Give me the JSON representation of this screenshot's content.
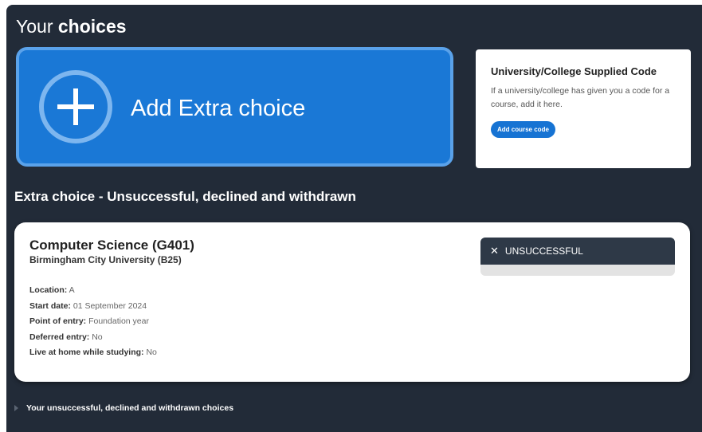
{
  "header": {
    "title_prefix": "Your",
    "title_bold": "choices"
  },
  "add_extra": {
    "label": "Add Extra choice",
    "icon": "plus-circle-icon"
  },
  "code_card": {
    "title": "University/College Supplied Code",
    "description": "If a university/college has given you a code for a course, add it here.",
    "button_label": "Add course code"
  },
  "section": {
    "title": "Extra choice - Unsuccessful, declined and withdrawn"
  },
  "choice": {
    "course": "Computer Science (G401)",
    "university": "Birmingham City University (B25)",
    "status": "UNSUCCESSFUL",
    "status_icon": "close-icon",
    "details": [
      {
        "label": "Location:",
        "value": "A"
      },
      {
        "label": "Start date:",
        "value": "01 September 2024"
      },
      {
        "label": "Point of entry:",
        "value": "Foundation year"
      },
      {
        "label": "Deferred entry:",
        "value": "No"
      },
      {
        "label": "Live at home while studying:",
        "value": "No"
      }
    ]
  },
  "toggle": {
    "label": "Your unsuccessful, declined and withdrawn choices",
    "icon": "triangle-right-icon"
  },
  "colors": {
    "panel_bg": "#222b38",
    "accent": "#1a78d6",
    "status_bg": "#2e3947"
  }
}
